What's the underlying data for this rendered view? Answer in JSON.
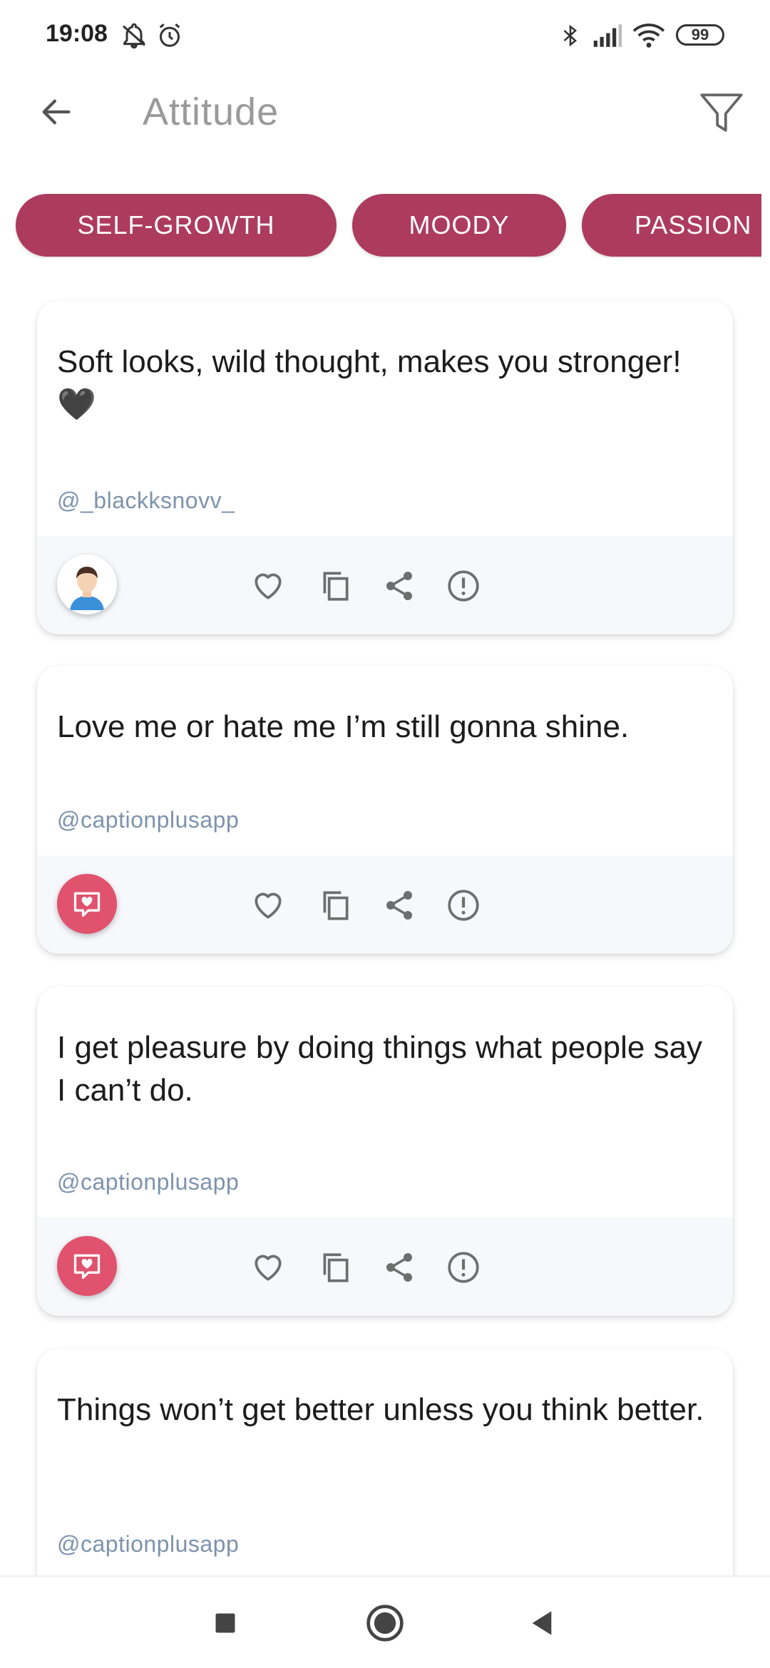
{
  "status_bar": {
    "time": "19:08",
    "battery": "99",
    "icons": [
      "mute-icon",
      "alarm-icon",
      "bluetooth-icon",
      "signal-icon",
      "wifi-icon",
      "battery-icon"
    ]
  },
  "app_bar": {
    "title": "Attitude",
    "back_icon": "arrow-left-icon",
    "filter_icon": "filter-icon"
  },
  "chips": [
    {
      "label": "SELF-GROWTH"
    },
    {
      "label": "MOODY"
    },
    {
      "label": "PASSION"
    }
  ],
  "cards": [
    {
      "text": "Soft looks, wild thought, makes you stronger! 🖤",
      "handle": "@_blackksnovv_",
      "avatar": "user-avatar"
    },
    {
      "text": "Love me or hate me I’m still gonna shine.",
      "handle": "@captionplusapp",
      "avatar": "app-logo"
    },
    {
      "text": "I get pleasure by doing things what people say I can’t do.",
      "handle": "@captionplusapp",
      "avatar": "app-logo"
    },
    {
      "text": "Things won’t get better unless you think better.",
      "handle": "@captionplusapp",
      "avatar": "app-logo"
    }
  ],
  "card_actions": [
    "heart-icon",
    "copy-icon",
    "share-icon",
    "report-icon"
  ],
  "colors": {
    "accent": "#ad3b5f",
    "app_logo": "#e0526d",
    "handle": "#7d93ad",
    "icon": "#6e6e6e"
  },
  "nav_bar": [
    "recents-button",
    "home-button",
    "back-button"
  ]
}
